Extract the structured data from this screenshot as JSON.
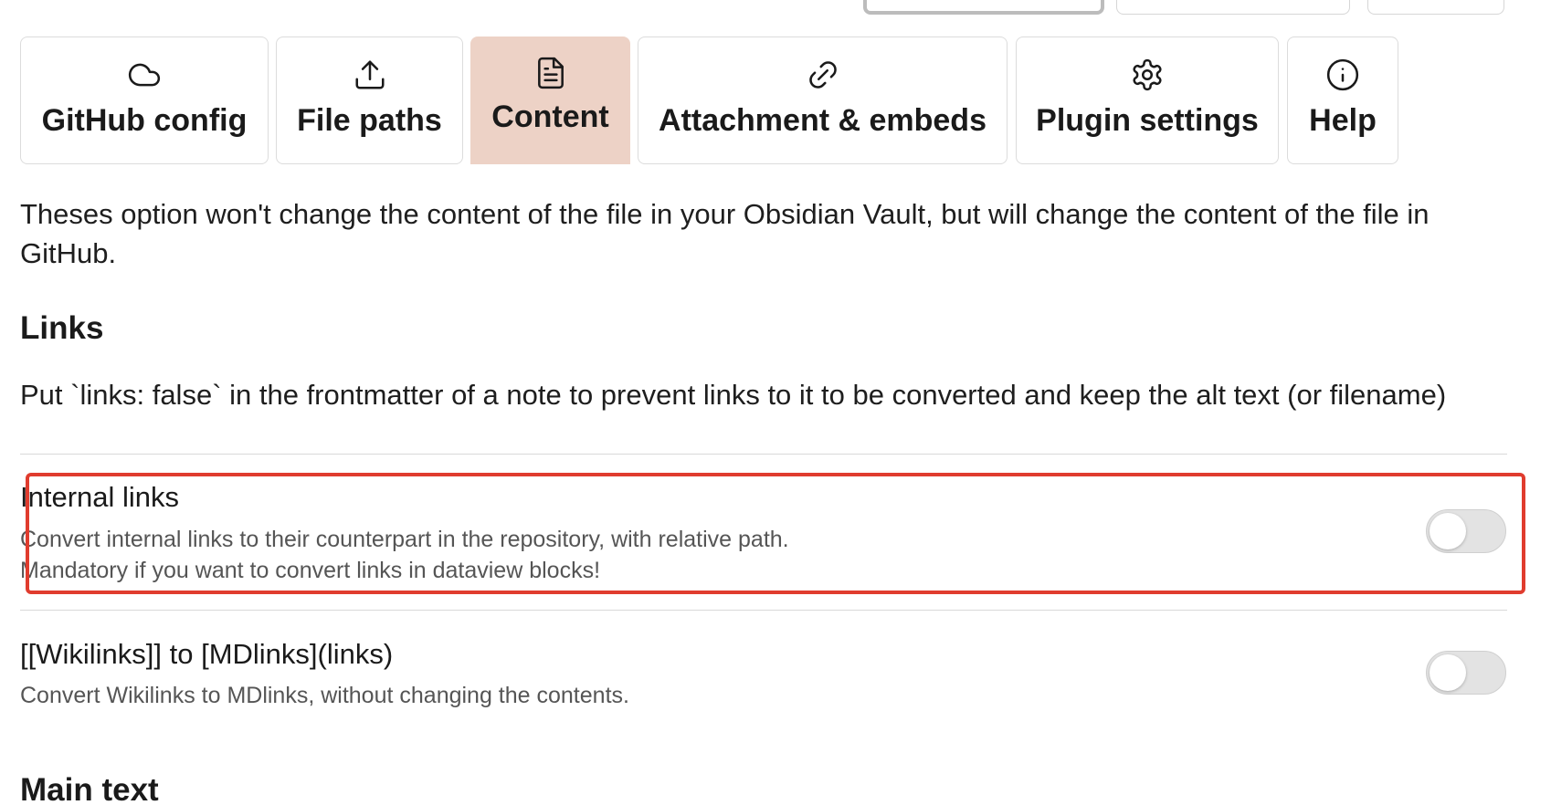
{
  "tabs": [
    {
      "label": "GitHub config",
      "icon": "cloud-icon"
    },
    {
      "label": "File paths",
      "icon": "upload-icon"
    },
    {
      "label": "Content",
      "icon": "file-text-icon",
      "active": true
    },
    {
      "label": "Attachment & embeds",
      "icon": "link-icon"
    },
    {
      "label": "Plugin settings",
      "icon": "gear-icon"
    },
    {
      "label": "Help",
      "icon": "info-icon"
    }
  ],
  "description": "Theses option won't change the content of the file in your Obsidian Vault, but will change the content of the file in GitHub.",
  "links_section": {
    "heading": "Links",
    "note": "Put `links: false` in the frontmatter of a note to prevent links to it to be converted and keep the alt text (or filename)",
    "settings": [
      {
        "name": "Internal links",
        "desc_line1": "Convert internal links to their counterpart in the repository, with relative path.",
        "desc_line2": "Mandatory if you want to convert links in dataview blocks!",
        "enabled": false,
        "highlighted": true
      },
      {
        "name": "[[Wikilinks]] to [MDlinks](links)",
        "desc_line1": "Convert Wikilinks to MDlinks, without changing the contents.",
        "enabled": false
      }
    ]
  },
  "main_text_section": {
    "heading": "Main text"
  },
  "colors": {
    "active_tab": "#edd2c6",
    "highlight_border": "#e03c2e",
    "toggle_off": "#e3e3e3"
  }
}
